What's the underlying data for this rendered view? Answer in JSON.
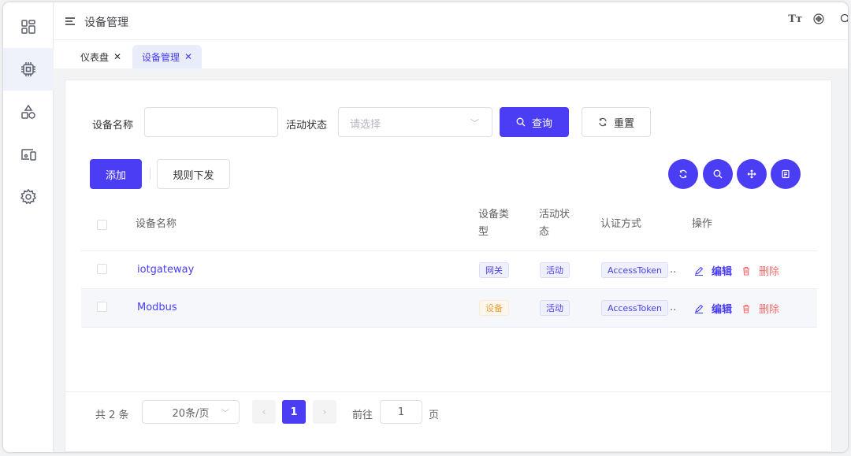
{
  "header": {
    "breadcrumb": "设备管理",
    "right_icons": [
      "font-size-icon",
      "target-icon",
      "search-icon"
    ]
  },
  "tabs": [
    {
      "label": "仪表盘",
      "close": "✕",
      "active": false
    },
    {
      "label": "设备管理",
      "close": "✕",
      "active": true
    }
  ],
  "sidebar": {
    "icons": [
      "dashboard-icon",
      "chip-icon",
      "shapes-icon",
      "devices-icon",
      "gear-icon"
    ],
    "active_index": 1
  },
  "search_form": {
    "device_name_label": "设备名称",
    "device_name_value": "",
    "status_label": "活动状态",
    "status_placeholder": "请选择",
    "query_label": "查询",
    "reset_label": "重置"
  },
  "toolbar": {
    "add_label": "添加",
    "rules_label": "规则下发"
  },
  "table": {
    "headers": {
      "name": "设备名称",
      "type_line1": "设备类",
      "type_line2": "型",
      "status_line1": "活动状",
      "status_line2": "态",
      "auth": "认证方式",
      "ops": "操作"
    },
    "rows": [
      {
        "name": "iotgateway",
        "type": "网关",
        "type_color": "blue",
        "status": "活动",
        "auth": "AccessToken",
        "more": "..",
        "edit": "编辑",
        "delete": "删除"
      },
      {
        "name": "Modbus",
        "type": "设备",
        "type_color": "orange",
        "status": "活动",
        "auth": "AccessToken",
        "more": "..",
        "edit": "编辑",
        "delete": "删除"
      }
    ]
  },
  "pagination": {
    "total": "共 2 条",
    "page_size": "20条/页",
    "current_page": "1",
    "goto_prefix": "前往",
    "goto_value": "1",
    "goto_suffix": "页"
  },
  "colors": {
    "primary": "#4a3df3",
    "danger": "#f56c6c",
    "warning": "#e6a23c"
  }
}
